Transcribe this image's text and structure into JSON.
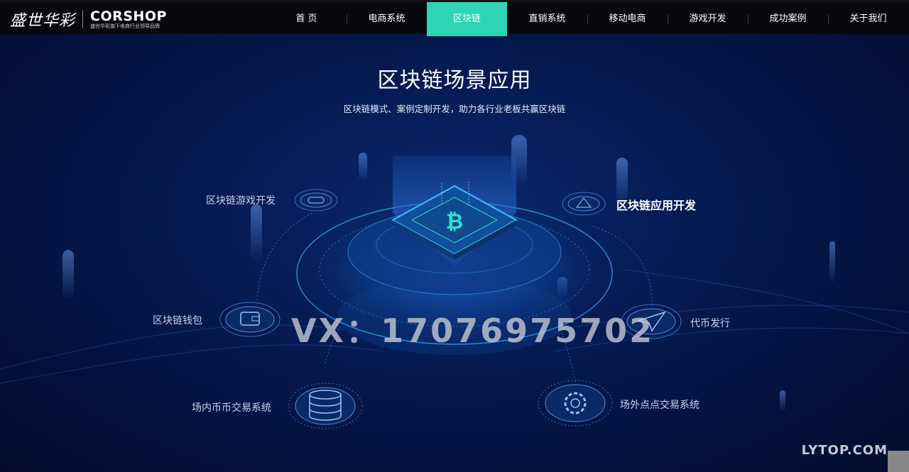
{
  "header": {
    "logo_cn": "盛世华彩",
    "logo_en": "CORSHOP",
    "logo_tagline": "盛世华彩旗下电商行业领导品牌",
    "nav": [
      {
        "label": "首 页"
      },
      {
        "label": "电商系统"
      },
      {
        "label": "区块链",
        "active": true
      },
      {
        "label": "直销系统"
      },
      {
        "label": "移动电商"
      },
      {
        "label": "游戏开发"
      },
      {
        "label": "成功案例"
      },
      {
        "label": "关于我们"
      }
    ]
  },
  "main": {
    "title": "区块链场景应用",
    "subtitle": "区块链模式、案例定制开发，助力各行业老板共赢区块链",
    "items": {
      "game": "区块链游戏开发",
      "app": "区块链应用开发",
      "wallet": "区块链钱包",
      "token": "代币发行",
      "exchange_in": "场内币币交易系统",
      "exchange_out": "场外点点交易系统"
    },
    "center_icon": "bitcoin-icon"
  },
  "overlay": {
    "watermark": "VX：17076975702",
    "corner_mark": "LYTOP.COM"
  },
  "colors": {
    "accent": "#2ed4b4",
    "background": "#061b55",
    "glow": "#3fb6ff"
  }
}
